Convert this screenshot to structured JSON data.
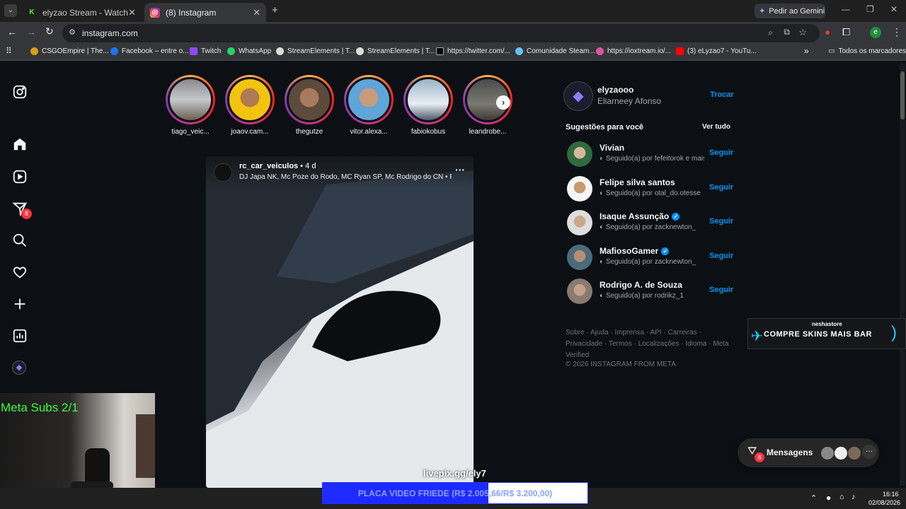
{
  "browser": {
    "tabs": [
      {
        "title": "elyzao Stream - Watch Live on K",
        "favicon_color": "#53fc18"
      },
      {
        "title": "(8) Instagram",
        "favicon_color": "#e1306c"
      }
    ],
    "new_tab_symbol": "+",
    "gemini_label": "Pedir ao Gemini",
    "url": "instagram.com",
    "profile_initial": "e",
    "bookmarks": [
      "CSGOEmpire | The...",
      "Facebook – entre o...",
      "Twitch",
      "WhatsApp",
      "StreamElements | T...",
      "StreamElements | T...",
      "https://twitter.com/...",
      "Comunidade Steam...",
      "https://ioxtream.io/...",
      "(3) eLyzao7 - YouTu..."
    ],
    "all_bookmarks": "Todos os marcadores"
  },
  "instagram": {
    "notifications_badge": "8",
    "stories": [
      "tiago_veic...",
      "joaov.cam...",
      "thegutze",
      "vitor.alexa...",
      "fabiokobus",
      "leandrobe..."
    ],
    "post": {
      "username": "rc_car_veiculos",
      "age": "• 4 d",
      "audio": "DJ Japa NK, Mc Poze do Rodo, MC Ryan SP, Mc Rodrigo do CN • Pa..."
    },
    "profile": {
      "username": "elyzaooo",
      "fullname": "Eliarneey Afonso",
      "switch": "Trocar"
    },
    "suggestions_title": "Sugestões para você",
    "see_all": "Ver tudo",
    "follow_label": "Seguir",
    "suggestions": [
      {
        "name": "Vivian",
        "sub": "Seguido(a) por fefeitorok e mais",
        "verified": false,
        "color": "#2f6b3b"
      },
      {
        "name": "Felipe silva santos",
        "sub": "Seguido(a) por otal_do.otesse",
        "verified": false,
        "color": "#c99a6b"
      },
      {
        "name": "Isaque Assunção",
        "sub": "Seguido(a) por zacknewton_",
        "verified": true,
        "color": "#ddd"
      },
      {
        "name": "MafiosoGamer",
        "sub": "Seguido(a) por zacknewton_",
        "verified": true,
        "color": "#4a6b7a"
      },
      {
        "name": "Rodrigo A. de Souza",
        "sub": "Seguido(a) por rodrikz_1",
        "verified": false,
        "color": "#8a7a70"
      }
    ],
    "footer_links": "Sobre · Ajuda · Imprensa · API · Carreiras · Privacidade · Termos · Localizações · Idioma · Meta Verified",
    "copyright": "© 2026 INSTAGRAM FROM META",
    "messages_label": "Mensagens",
    "messages_badge": "8"
  },
  "overlay": {
    "meta_subs": "Meta Subs 2/1",
    "livepix": "livepix.gg/ely7",
    "goal": "PLACA VIDEO FRIEDE (R$ 2.005,66/R$ 3.200,00)",
    "goal_progress": 0.627,
    "ad_brand": "neshastore",
    "ad_text": "COMPRE SKINS MAIS BAR"
  },
  "taskbar": {
    "time": "16:16",
    "date": "02/08/2026"
  }
}
